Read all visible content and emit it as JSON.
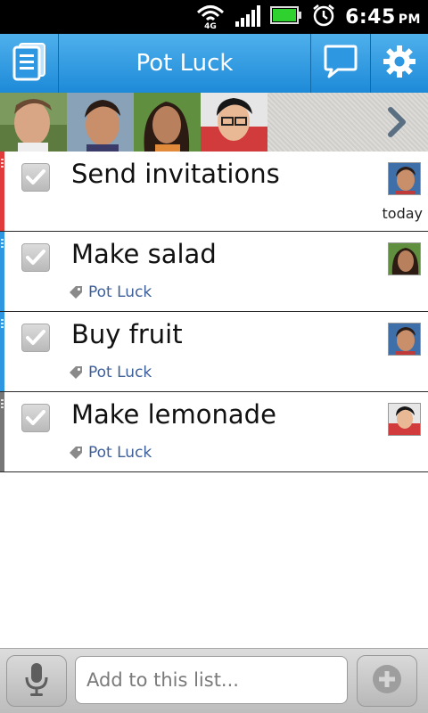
{
  "status_bar": {
    "time": "6:45",
    "ampm": "PM",
    "network_label": "4G",
    "icons": [
      "wifi-4g-icon",
      "signal-icon",
      "battery-icon",
      "alarm-icon"
    ]
  },
  "title_bar": {
    "title": "Pot Luck",
    "left_icon": "list-icon",
    "right_icons": [
      "chat-icon",
      "gear-icon"
    ],
    "color": "#2d97e2"
  },
  "members": {
    "count_visible": 4,
    "more_icon": "chevron-right-icon"
  },
  "tasks": [
    {
      "title": "Send invitations",
      "done": true,
      "stripe_color": "#e03a3a",
      "due": "today",
      "tag": ""
    },
    {
      "title": "Make salad",
      "done": true,
      "stripe_color": "#2d97e2",
      "due": "",
      "tag": "Pot Luck"
    },
    {
      "title": "Buy fruit",
      "done": true,
      "stripe_color": "#2d97e2",
      "due": "",
      "tag": "Pot Luck"
    },
    {
      "title": "Make lemonade",
      "done": true,
      "stripe_color": "#777777",
      "due": "",
      "tag": "Pot Luck"
    }
  ],
  "bottom_bar": {
    "input_placeholder": "Add to this list...",
    "input_value": "",
    "left_icon": "microphone-icon",
    "right_icon": "add-icon"
  },
  "colors": {
    "accent": "#2d97e2",
    "tag_text": "#3d5f9a"
  }
}
